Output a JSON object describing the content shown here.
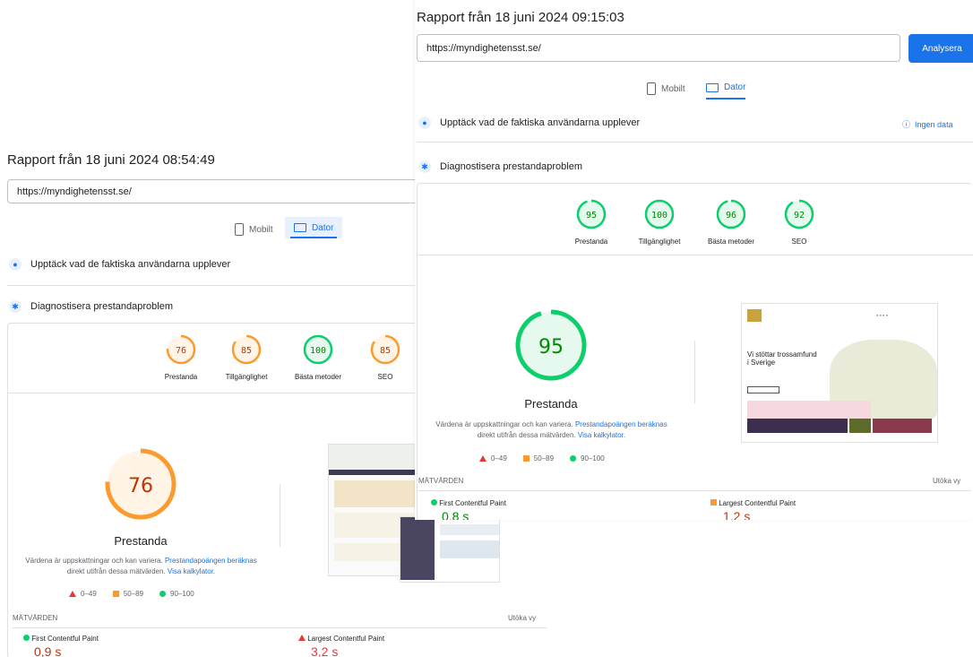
{
  "left": {
    "title": "Rapport från 18 juni 2024 08:54:49",
    "url": "https://myndighetensst.se/",
    "tabs": {
      "mobile": "Mobilt",
      "desktop": "Dator"
    },
    "section_real_users": "Upptäck vad de faktiska användarna upplever",
    "section_diagnose": "Diagnostisera prestandaproblem",
    "scores": [
      {
        "label": "Prestanda",
        "value": 76
      },
      {
        "label": "Tillgänglighet",
        "value": 85
      },
      {
        "label": "Bästa metoder",
        "value": 100
      },
      {
        "label": "SEO",
        "value": 85
      }
    ],
    "big_score": 76,
    "big_label": "Prestanda",
    "desc_1": "Värdena är uppskattningar och kan variera.",
    "desc_link_1": "Prestandapoängen beräknas",
    "desc_2": "direkt utifrån dessa mätvärden.",
    "desc_link_2": "Visa kalkylator.",
    "legend": [
      "0–49",
      "50–89",
      "90–100"
    ],
    "metrics_header": "MÄTVÄRDEN",
    "expand_view": "Utöka vy",
    "metric_fcp_label": "First Contentful Paint",
    "metric_fcp_value": "0,9 s",
    "metric_lcp_label": "Largest Contentful Paint",
    "metric_lcp_value": "3,2 s"
  },
  "right": {
    "title": "Rapport från 18 juni 2024 09:15:03",
    "url": "https://myndighetensst.se/",
    "analyze_button": "Analysera",
    "tabs": {
      "mobile": "Mobilt",
      "desktop": "Dator"
    },
    "section_real_users": "Upptäck vad de faktiska användarna upplever",
    "no_data": "Ingen data",
    "section_diagnose": "Diagnostisera prestandaproblem",
    "scores": [
      {
        "label": "Prestanda",
        "value": 95
      },
      {
        "label": "Tillgänglighet",
        "value": 100
      },
      {
        "label": "Bästa metoder",
        "value": 96
      },
      {
        "label": "SEO",
        "value": 92
      }
    ],
    "big_score": 95,
    "big_label": "Prestanda",
    "desc_1": "Värdena är uppskattningar och kan variera.",
    "desc_link_1": "Prestandapoängen beräknas",
    "desc_2": "direkt utifrån dessa mätvärden.",
    "desc_link_2": "Visa kalkylator.",
    "legend": [
      "0–49",
      "50–89",
      "90–100"
    ],
    "metrics_header": "MÄTVÄRDEN",
    "expand_view": "Utöka vy",
    "metric_fcp_label": "First Contentful Paint",
    "metric_fcp_value": "0,8 s",
    "metric_lcp_label": "Largest Contentful Paint",
    "metric_lcp_value": "1,2 s",
    "thumb_heading": "Vi stöttar trossamfund i Sverige"
  },
  "colors": {
    "good": "#0cce6b",
    "average": "#fa9b2f",
    "poor": "#e53935",
    "accent": "#1a73e8"
  }
}
